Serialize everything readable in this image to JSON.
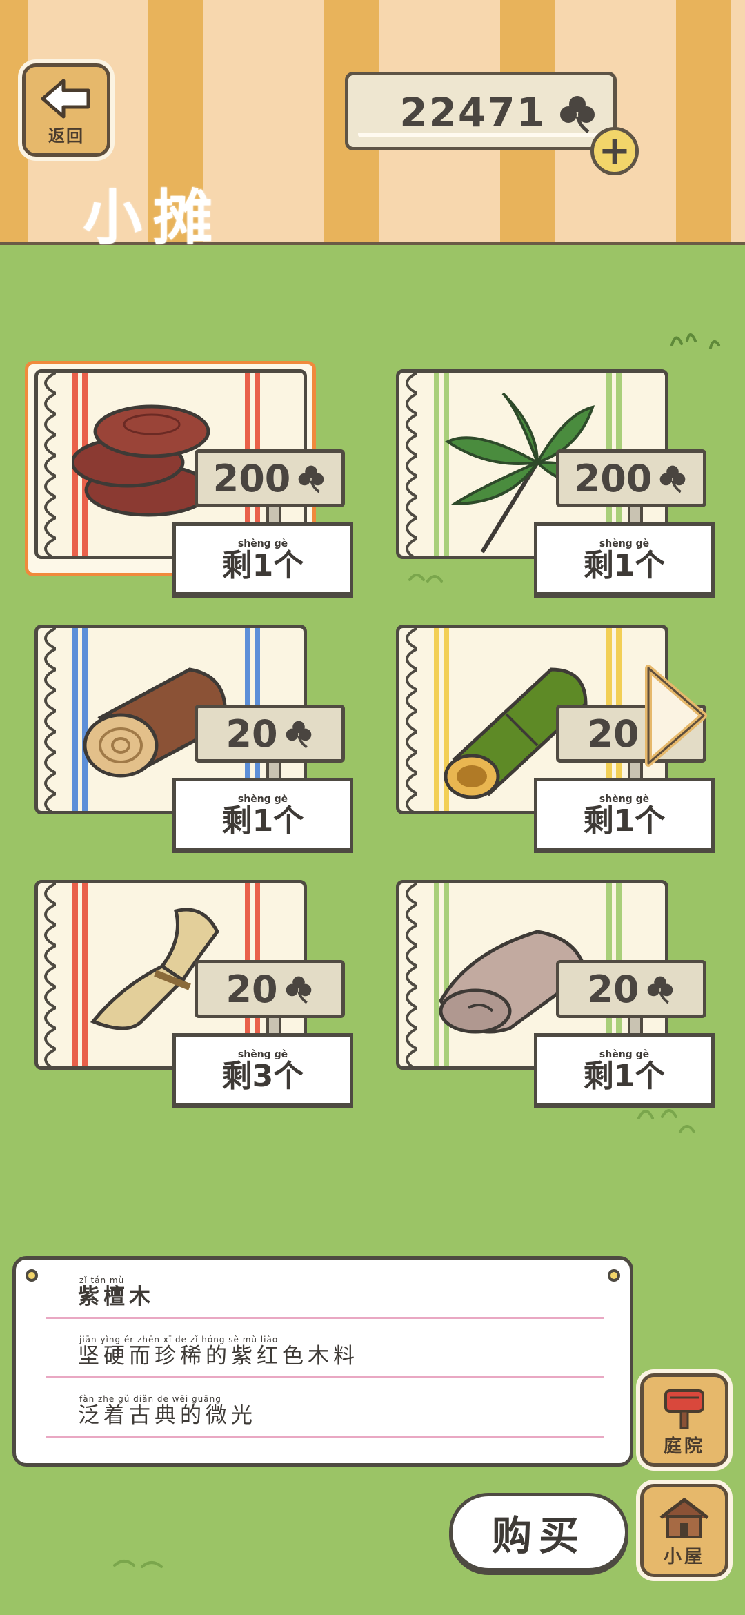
{
  "header": {
    "back_label": "返回",
    "title": "小摊",
    "currency_value": "22471",
    "currency_icon": "clover-icon",
    "add_icon": "plus-icon"
  },
  "items": [
    {
      "name": "紫檀木",
      "price": "200",
      "stock_label": "剩1个",
      "stock_pinyin": "shèng     gè",
      "stripe_color": "#e9604a",
      "selected": true,
      "icon": "red-sandalwood-slices-icon"
    },
    {
      "name": "棕榈叶",
      "price": "200",
      "stock_label": "剩1个",
      "stock_pinyin": "shèng     gè",
      "stripe_color": "#a9cf7a",
      "selected": false,
      "icon": "palm-leaf-icon"
    },
    {
      "name": "木头",
      "price": "20",
      "stock_label": "剩1个",
      "stock_pinyin": "shèng     gè",
      "stripe_color": "#5d8fd8",
      "selected": false,
      "icon": "log-icon"
    },
    {
      "name": "竹子",
      "price": "20",
      "stock_label": "剩1个",
      "stock_pinyin": "shèng     gè",
      "stripe_color": "#f2cf55",
      "selected": false,
      "icon": "bamboo-icon"
    },
    {
      "name": "稻草",
      "price": "20",
      "stock_label": "剩3个",
      "stock_pinyin": "shèng     gè",
      "stripe_color": "#e9604a",
      "selected": false,
      "icon": "straw-bundle-icon"
    },
    {
      "name": "布料",
      "price": "20",
      "stock_label": "剩1个",
      "stock_pinyin": "shèng     gè",
      "stripe_color": "#a9cf7a",
      "selected": false,
      "icon": "cloth-roll-icon"
    }
  ],
  "description": {
    "title": "紫檀木",
    "title_pinyin": "zǐ   tán   mù",
    "line1": "坚硬而珍稀的紫红色木料",
    "line1_pinyin": "jiān  yìng  ér  zhēn  xī   de   zǐ  hóng  sè   mù  liào",
    "line2": "泛着古典的微光",
    "line2_pinyin": "fàn  zhe  gǔ  diǎn  de  wēi guāng"
  },
  "buttons": {
    "buy": "购买",
    "courtyard": "庭院",
    "house": "小屋"
  },
  "colors": {
    "grass": "#9bc466",
    "header_stripe_dark": "#e8b35b",
    "header_stripe_light": "#f7d7ae",
    "selection_border": "#f08a3c",
    "wood_button": "#e6b86b"
  }
}
